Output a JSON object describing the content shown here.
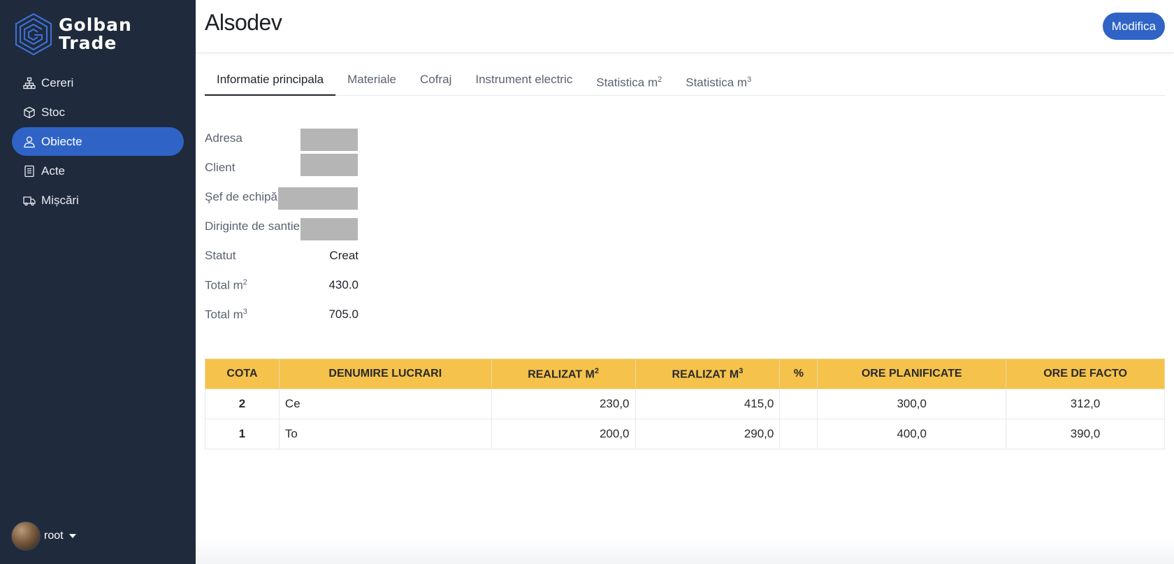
{
  "app": {
    "logo_line1": "Golban",
    "logo_line2": "Trade"
  },
  "sidebar": {
    "items": [
      {
        "label": "Cereri",
        "icon": "sitemap-icon"
      },
      {
        "label": "Stoc",
        "icon": "box-icon"
      },
      {
        "label": "Obiecte",
        "icon": "user-icon"
      },
      {
        "label": "Acte",
        "icon": "document-icon"
      },
      {
        "label": "Mișcări",
        "icon": "truck-icon"
      }
    ],
    "active_index": 2,
    "user": {
      "name": "root"
    }
  },
  "header": {
    "title": "Alsodev",
    "edit_label": "Modifica"
  },
  "tabs": [
    {
      "label": "Informatie principala",
      "sup": ""
    },
    {
      "label": "Materiale",
      "sup": ""
    },
    {
      "label": "Cofraj",
      "sup": ""
    },
    {
      "label": "Instrument electric",
      "sup": ""
    },
    {
      "label": "Statistica m",
      "sup": "2"
    },
    {
      "label": "Statistica m",
      "sup": "3"
    }
  ],
  "info": {
    "adresa_label": "Adresa",
    "client_label": "Client",
    "sef_label": "Şef de echipă",
    "diriginte_label": "Diriginte de santier",
    "statut_label": "Statut",
    "statut_value": "Creat",
    "total_m2_label": "Total m",
    "total_m2_sup": "2",
    "total_m2_value": "430.0",
    "total_m3_label": "Total m",
    "total_m3_sup": "3",
    "total_m3_value": "705.0"
  },
  "table": {
    "headers": {
      "cota": "Cota",
      "denumire": "Denumire lucrari",
      "realizat_m2": "Realizat m",
      "realizat_m2_sup": "2",
      "realizat_m3": "Realizat m",
      "realizat_m3_sup": "3",
      "percent": "%",
      "ore_planificate": "Ore planificate",
      "ore_facto": "Ore de facto"
    },
    "rows": [
      {
        "cota": "2",
        "denumire": "Ce",
        "realizat_m2": "230,0",
        "realizat_m3": "415,0",
        "percent": "",
        "ore_planificate": "300,0",
        "ore_facto": "312,0"
      },
      {
        "cota": "1",
        "denumire": "To",
        "realizat_m2": "200,0",
        "realizat_m3": "290,0",
        "percent": "",
        "ore_planificate": "400,0",
        "ore_facto": "390,0"
      }
    ]
  },
  "colors": {
    "sidebar_bg": "#1f2a3c",
    "accent": "#2f64c6",
    "table_header": "#f5c24b"
  }
}
